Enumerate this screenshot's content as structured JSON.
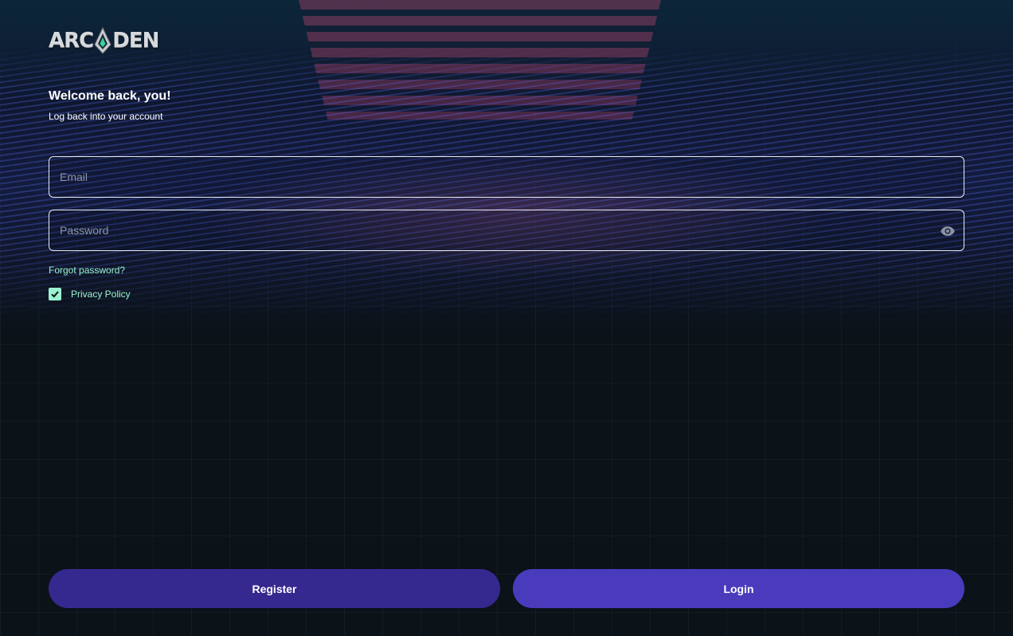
{
  "brand": {
    "logo_text_left": "ARC",
    "logo_text_right": "DEN",
    "logo_icon": "arcaden-gem-icon"
  },
  "form": {
    "heading": "Welcome back, you!",
    "subheading": "Log back into your account",
    "email": {
      "value": "",
      "placeholder": "Email"
    },
    "password": {
      "value": "",
      "placeholder": "Password",
      "toggle_icon": "eye-icon"
    },
    "forgot_password": "Forgot password?",
    "privacy": {
      "label": "Privacy Policy",
      "checked": true
    }
  },
  "actions": {
    "register_label": "Register",
    "login_label": "Login"
  },
  "colors": {
    "accent": "#9af2d0",
    "register_button": "#35298f",
    "login_button": "#4a3bbd",
    "background": "#0b1218"
  }
}
